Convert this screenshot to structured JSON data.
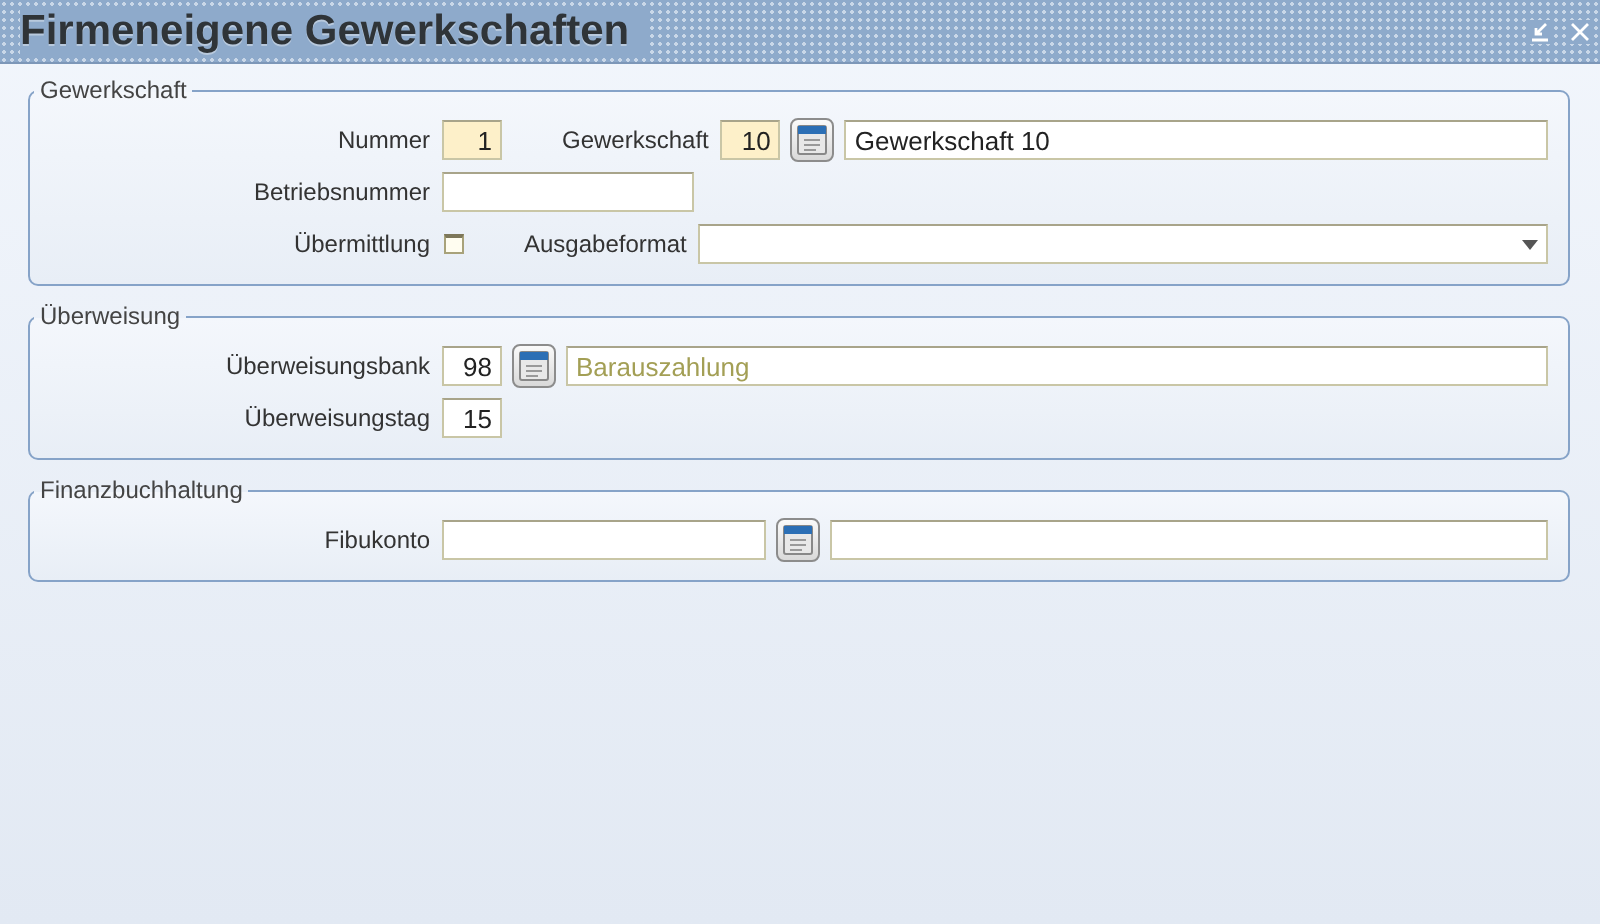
{
  "window": {
    "title": "Firmeneigene Gewerkschaften"
  },
  "sections": [
    {
      "title": "Gewerkschaft",
      "rows": [
        {
          "label": "Nummer",
          "items": [
            {
              "kind": "number",
              "value": "1",
              "highlighted": true
            },
            {
              "kind": "label",
              "text": "Gewerkschaft"
            },
            {
              "kind": "number",
              "value": "10",
              "highlighted": true
            },
            {
              "kind": "lookup"
            },
            {
              "kind": "text",
              "value": "Gewerkschaft 10",
              "readonly": false
            }
          ]
        },
        {
          "label": "Betriebsnummer",
          "items": [
            {
              "kind": "id",
              "value": "",
              "highlighted": false
            }
          ]
        },
        {
          "label": "Übermittlung",
          "items": [
            {
              "kind": "checkbox",
              "checked": false
            },
            {
              "kind": "label",
              "text": "Ausgabeformat"
            },
            {
              "kind": "dropdown",
              "value": ""
            }
          ]
        }
      ]
    },
    {
      "title": "Überweisung",
      "rows": [
        {
          "label": "Überweisungsbank",
          "items": [
            {
              "kind": "number",
              "value": "98",
              "highlighted": false
            },
            {
              "kind": "lookup"
            },
            {
              "kind": "text",
              "value": "Barauszahlung",
              "readonly": true
            }
          ]
        },
        {
          "label": "Überweisungstag",
          "items": [
            {
              "kind": "number",
              "value": "15",
              "highlighted": false
            }
          ]
        }
      ]
    },
    {
      "title": "Finanzbuchhaltung",
      "rows": [
        {
          "label": "Fibukonto",
          "items": [
            {
              "kind": "account",
              "value": "",
              "highlighted": false
            },
            {
              "kind": "lookup"
            },
            {
              "kind": "text",
              "value": ""
            }
          ]
        }
      ]
    }
  ]
}
